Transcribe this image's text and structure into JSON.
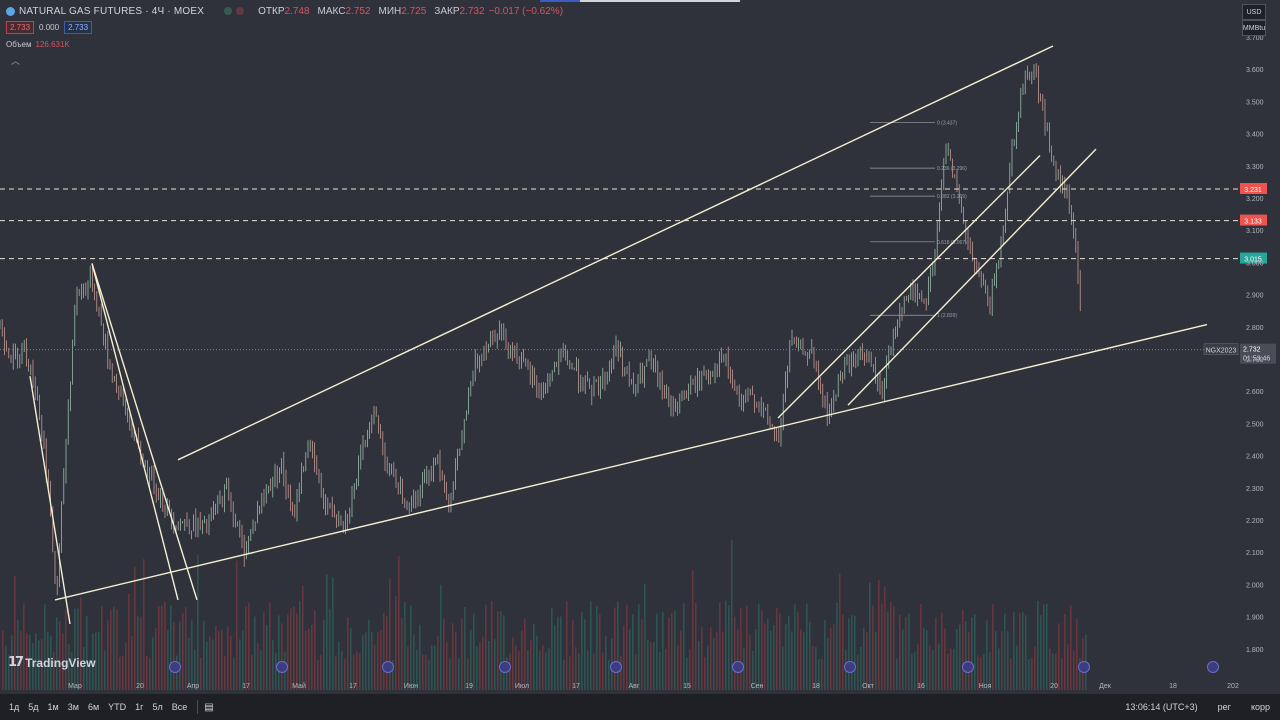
{
  "header": {
    "symbol": "NATURAL GAS FUTURES · 4Ч · MOEX",
    "open_label": "ОТКР",
    "open": "2.748",
    "high_label": "МАКС",
    "high": "2.752",
    "low_label": "МИН",
    "low": "2.725",
    "close_label": "ЗАКР",
    "close": "2.732",
    "change": "−0.017 (−0.62%)",
    "sell": "2.733",
    "spread": "0.000",
    "buy": "2.733",
    "volume_label": "Объем",
    "volume": "126.631K"
  },
  "units": {
    "currency": "USD",
    "unit": "MMBtu"
  },
  "logo": {
    "text": "TradingView"
  },
  "bottom_bar": {
    "timeframes": [
      "1д",
      "5д",
      "1м",
      "3м",
      "6м",
      "YTD",
      "1г",
      "5л",
      "Все"
    ],
    "clock": "13:06:14 (UTC+3)",
    "scale_mode": "рег",
    "correction": "корр"
  },
  "colors": {
    "up": "#26a69a",
    "down": "#ef5350",
    "line": "#f5efd0",
    "bg": "#2f323b"
  },
  "chart_data": {
    "type": "candlestick",
    "ylim": [
      1.76,
      3.72
    ],
    "y_ticks": [
      "3.700",
      "3.600",
      "3.500",
      "3.400",
      "3.300",
      "3.200",
      "3.100",
      "3.000",
      "2.900",
      "2.800",
      "2.700",
      "2.600",
      "2.500",
      "2.400",
      "2.300",
      "2.200",
      "2.100",
      "2.000",
      "1.900",
      "1.800"
    ],
    "x_ticks": [
      "Мар",
      "20",
      "Апр",
      "17",
      "Май",
      "17",
      "Июн",
      "19",
      "Июл",
      "17",
      "Авг",
      "15",
      "Сен",
      "18",
      "Окт",
      "16",
      "Ноя",
      "20",
      "Дек",
      "18",
      "202"
    ],
    "price_path": [
      [
        0,
        2.8
      ],
      [
        0.012,
        2.7
      ],
      [
        0.022,
        2.75
      ],
      [
        0.035,
        2.58
      ],
      [
        0.045,
        2.3
      ],
      [
        0.052,
        1.95
      ],
      [
        0.06,
        2.4
      ],
      [
        0.07,
        2.9
      ],
      [
        0.085,
        2.95
      ],
      [
        0.1,
        2.7
      ],
      [
        0.13,
        2.4
      ],
      [
        0.16,
        2.2
      ],
      [
        0.19,
        2.18
      ],
      [
        0.21,
        2.3
      ],
      [
        0.225,
        2.1
      ],
      [
        0.24,
        2.25
      ],
      [
        0.26,
        2.38
      ],
      [
        0.27,
        2.2
      ],
      [
        0.285,
        2.45
      ],
      [
        0.3,
        2.25
      ],
      [
        0.32,
        2.2
      ],
      [
        0.345,
        2.55
      ],
      [
        0.36,
        2.35
      ],
      [
        0.38,
        2.25
      ],
      [
        0.405,
        2.4
      ],
      [
        0.415,
        2.25
      ],
      [
        0.44,
        2.7
      ],
      [
        0.46,
        2.8
      ],
      [
        0.48,
        2.7
      ],
      [
        0.5,
        2.6
      ],
      [
        0.52,
        2.72
      ],
      [
        0.545,
        2.6
      ],
      [
        0.56,
        2.65
      ],
      [
        0.57,
        2.75
      ],
      [
        0.585,
        2.6
      ],
      [
        0.6,
        2.7
      ],
      [
        0.62,
        2.55
      ],
      [
        0.65,
        2.65
      ],
      [
        0.67,
        2.7
      ],
      [
        0.685,
        2.55
      ],
      [
        0.695,
        2.6
      ],
      [
        0.72,
        2.45
      ],
      [
        0.73,
        2.75
      ],
      [
        0.75,
        2.72
      ],
      [
        0.765,
        2.52
      ],
      [
        0.78,
        2.68
      ],
      [
        0.8,
        2.72
      ],
      [
        0.815,
        2.6
      ],
      [
        0.83,
        2.85
      ],
      [
        0.845,
        2.92
      ],
      [
        0.855,
        2.88
      ],
      [
        0.865,
        3.05
      ],
      [
        0.875,
        3.4
      ],
      [
        0.885,
        3.2
      ],
      [
        0.895,
        3.05
      ],
      [
        0.905,
        2.95
      ],
      [
        0.915,
        2.88
      ],
      [
        0.925,
        3.05
      ],
      [
        0.935,
        3.35
      ],
      [
        0.945,
        3.55
      ],
      [
        0.955,
        3.62
      ],
      [
        0.965,
        3.45
      ],
      [
        0.975,
        3.28
      ],
      [
        0.985,
        3.22
      ],
      [
        0.995,
        3.05
      ],
      [
        1.0,
        2.732
      ]
    ],
    "volume": "126.631K",
    "horizontal_levels": [
      {
        "value": 3.231,
        "label": "3.231",
        "color": "#ef5350"
      },
      {
        "value": 3.133,
        "label": "3.133",
        "color": "#ef5350"
      },
      {
        "value": 3.015,
        "label": "3.015",
        "color": "#26a69a"
      }
    ],
    "last_price": {
      "value": 2.732,
      "label": "2.732",
      "countdown": "01:53:46",
      "instrument": "NGX2023"
    },
    "fibonacci": [
      {
        "level": "0 (3.437)",
        "value": 3.437
      },
      {
        "level": "0.236 (3.296)",
        "value": 3.296
      },
      {
        "level": "0.382 (3.209)",
        "value": 3.209
      },
      {
        "level": "0.618 (3.067)",
        "value": 3.067
      },
      {
        "level": "1 (2.839)",
        "value": 2.839
      }
    ]
  }
}
